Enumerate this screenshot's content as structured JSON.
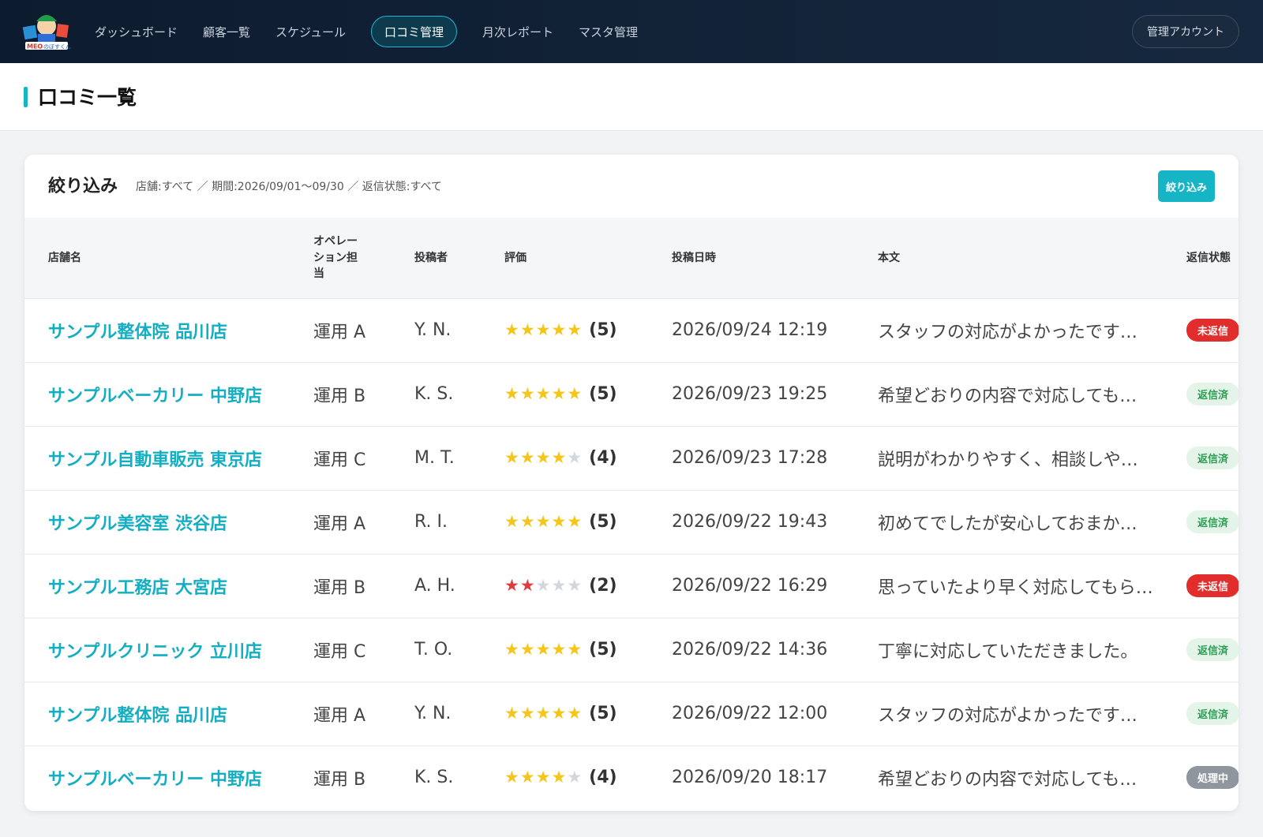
{
  "header": {
    "logo_text": "MEOのぼすくん",
    "nav": [
      {
        "label": "ダッシュボード",
        "active": false
      },
      {
        "label": "顧客一覧",
        "active": false
      },
      {
        "label": "スケジュール",
        "active": false
      },
      {
        "label": "口コミ管理",
        "active": true
      },
      {
        "label": "月次レポート",
        "active": false
      },
      {
        "label": "マスタ管理",
        "active": false
      }
    ],
    "account_label": "管理アカウント"
  },
  "page": {
    "title": "口コミ一覧"
  },
  "filter": {
    "label": "絞り込み",
    "summary": "店舗:すべて ／ 期間:2026/09/01〜09/30 ／ 返信状態:すべて",
    "button_label": "絞り込み"
  },
  "table": {
    "columns": {
      "store": "店舗名",
      "operator": "オペレーション担当",
      "poster": "投稿者",
      "rating": "評価",
      "datetime": "投稿日時",
      "body": "本文",
      "status": "返信状態"
    },
    "rows": [
      {
        "store": "サンプル整体院 品川店",
        "operator": "運用 A",
        "poster": "Y. N.",
        "rating": 5,
        "rating_label": "(5)",
        "datetime": "2026/09/24 12:19",
        "body": "スタッフの対応がよかったです…",
        "status": "未返信",
        "status_type": "unreplied"
      },
      {
        "store": "サンプルベーカリー 中野店",
        "operator": "運用 B",
        "poster": "K. S.",
        "rating": 5,
        "rating_label": "(5)",
        "datetime": "2026/09/23 19:25",
        "body": "希望どおりの内容で対応しても…",
        "status": "返信済",
        "status_type": "replied"
      },
      {
        "store": "サンプル自動車販売 東京店",
        "operator": "運用 C",
        "poster": "M. T.",
        "rating": 4,
        "rating_label": "(4)",
        "datetime": "2026/09/23 17:28",
        "body": "説明がわかりやすく、相談しや…",
        "status": "返信済",
        "status_type": "replied"
      },
      {
        "store": "サンプル美容室 渋谷店",
        "operator": "運用 A",
        "poster": "R. I.",
        "rating": 5,
        "rating_label": "(5)",
        "datetime": "2026/09/22 19:43",
        "body": "初めてでしたが安心しておまか…",
        "status": "返信済",
        "status_type": "replied"
      },
      {
        "store": "サンプル工務店 大宮店",
        "operator": "運用 B",
        "poster": "A. H.",
        "rating": 2,
        "rating_label": "(2)",
        "datetime": "2026/09/22 16:29",
        "body": "思っていたより早く対応してもら…",
        "status": "未返信",
        "status_type": "unreplied"
      },
      {
        "store": "サンプルクリニック 立川店",
        "operator": "運用 C",
        "poster": "T. O.",
        "rating": 5,
        "rating_label": "(5)",
        "datetime": "2026/09/22 14:36",
        "body": "丁寧に対応していただきました。",
        "status": "返信済",
        "status_type": "replied"
      },
      {
        "store": "サンプル整体院 品川店",
        "operator": "運用 A",
        "poster": "Y. N.",
        "rating": 5,
        "rating_label": "(5)",
        "datetime": "2026/09/22 12:00",
        "body": "スタッフの対応がよかったです…",
        "status": "返信済",
        "status_type": "replied"
      },
      {
        "store": "サンプルベーカリー 中野店",
        "operator": "運用 B",
        "poster": "K. S.",
        "rating": 4,
        "rating_label": "(4)",
        "datetime": "2026/09/20 18:17",
        "body": "希望どおりの内容で対応しても…",
        "status": "処理中",
        "status_type": "processing"
      }
    ]
  },
  "colors": {
    "accent": "#15b5c6",
    "header_bg": "#0d1b2e",
    "star": "#f5c518",
    "star_low": "#e23b3b",
    "unreplied": "#e22d2d",
    "replied": "#2e9d54"
  }
}
